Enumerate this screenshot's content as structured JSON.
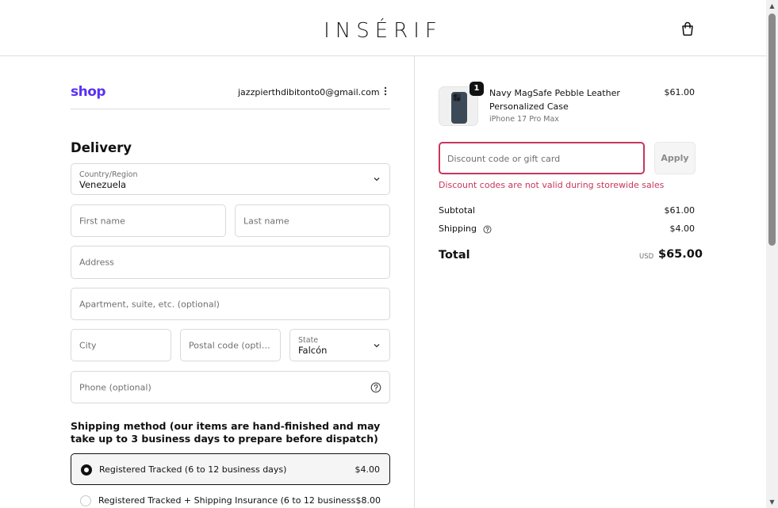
{
  "header": {
    "brand": "INSÉRIF",
    "cart_icon": "shopping-bag-icon"
  },
  "account": {
    "shop_label": "shop",
    "email": "jazzpierthdibitonto0@gmail.com",
    "menu_icon": "more-vertical-icon"
  },
  "delivery": {
    "title": "Delivery",
    "country_label": "Country/Region",
    "country_value": "Venezuela",
    "first_name_placeholder": "First name",
    "last_name_placeholder": "Last name",
    "address_placeholder": "Address",
    "apartment_placeholder": "Apartment, suite, etc. (optional)",
    "city_placeholder": "City",
    "postal_placeholder": "Postal code (option...",
    "state_label": "State",
    "state_value": "Falcón",
    "phone_placeholder": "Phone (optional)"
  },
  "shipping": {
    "title": "Shipping method (our items are hand-finished and may take up to 3 business days to prepare before dispatch)",
    "options": [
      {
        "label": "Registered Tracked (6 to 12 business days)",
        "price": "$4.00",
        "selected": true
      },
      {
        "label": "Registered Tracked + Shipping Insurance (6 to 12 business",
        "price": "$8.00",
        "selected": false
      }
    ]
  },
  "order": {
    "item": {
      "quantity": "1",
      "name": "Navy MagSafe Pebble Leather Personalized Case",
      "variant": "iPhone 17 Pro Max",
      "price": "$61.00"
    },
    "discount_placeholder": "Discount code or gift card",
    "apply_label": "Apply",
    "discount_error": "Discount codes are not valid during storewide sales",
    "subtotal_label": "Subtotal",
    "subtotal_value": "$61.00",
    "shipping_label": "Shipping",
    "shipping_value": "$4.00",
    "total_label": "Total",
    "total_currency": "USD",
    "total_value": "$65.00"
  },
  "colors": {
    "accent_error": "#c7365f",
    "shop_purple": "#5a31f4"
  }
}
